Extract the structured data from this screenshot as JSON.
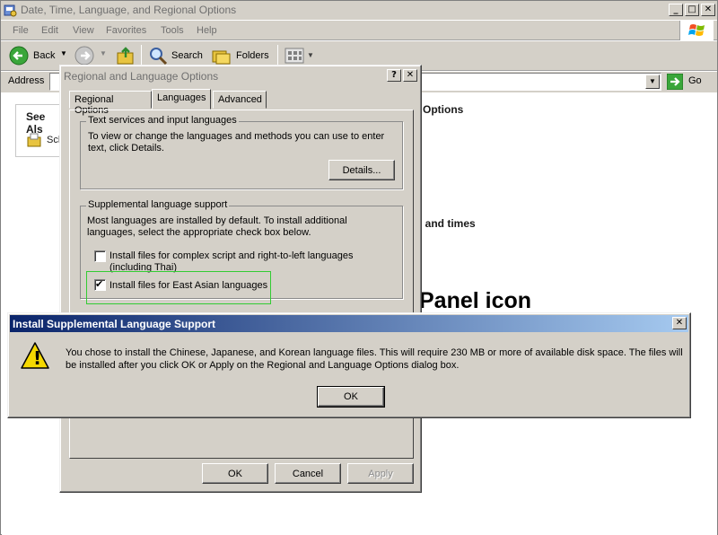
{
  "explorer": {
    "title": "Date, Time, Language, and Regional Options",
    "menu": [
      "File",
      "Edit",
      "View",
      "Favorites",
      "Tools",
      "Help"
    ],
    "toolbar": {
      "back": "Back",
      "search": "Search",
      "folders": "Folders"
    },
    "address_label": "Address",
    "go_label": "Go",
    "see_also": "See Als",
    "sch_link": "Sch",
    "bg_options": "Options",
    "bg_times": ", and times",
    "bg_panel_icon": "Panel icon"
  },
  "regional_dialog": {
    "title": "Regional and Language Options",
    "help_btn": "?",
    "close_btn": "✕",
    "tabs": [
      "Regional Options",
      "Languages",
      "Advanced"
    ],
    "active_tab": "Languages",
    "text_services": {
      "group_title": "Text services and input languages",
      "description": "To view or change the languages and methods you can use to enter text, click Details.",
      "details_button": "Details..."
    },
    "supplemental": {
      "group_title": "Supplemental language support",
      "description": "Most languages are installed by default. To install additional languages, select the appropriate check box below.",
      "complex_script_label": "Install files for complex script and right-to-left languages (including Thai)",
      "complex_script_checked": false,
      "east_asian_label": "Install files for East Asian languages",
      "east_asian_checked": true,
      "checkmark": "✔"
    },
    "ok": "OK",
    "cancel": "Cancel",
    "apply": "Apply"
  },
  "alert": {
    "title": "Install Supplemental Language Support",
    "close_btn": "✕",
    "message": "You chose to install the Chinese, Japanese, and Korean language files. This will require 230 MB or more of available disk space. The files will be installed after you click OK or Apply on the Regional and Language Options dialog box.",
    "warning_icon_glyph": "!",
    "ok": "OK"
  },
  "colors": {
    "titlebar_active_start": "#0a246a",
    "titlebar_active_end": "#a6caf0",
    "highlight_box": "#33cc33",
    "face": "#d4d0c8"
  }
}
